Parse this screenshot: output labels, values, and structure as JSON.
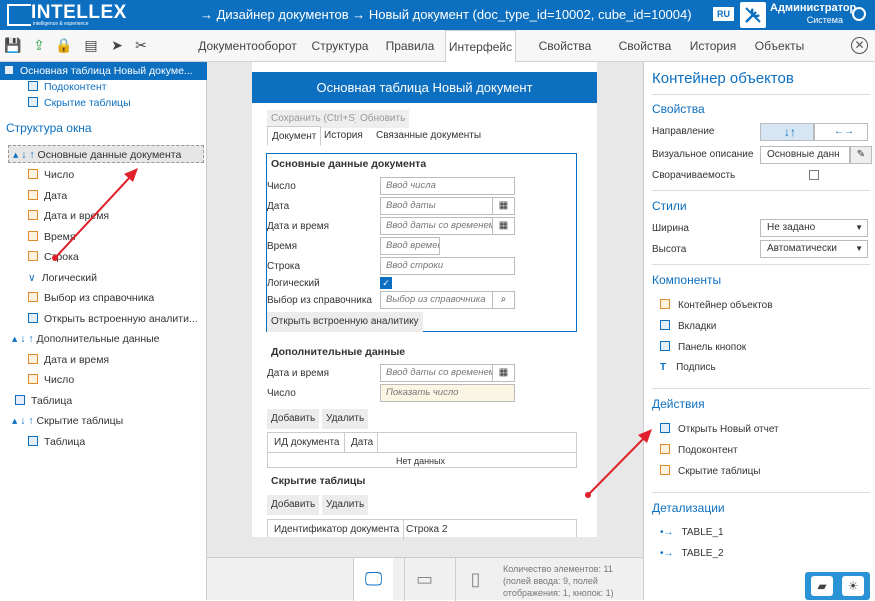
{
  "header": {
    "logo": "INTELLEX",
    "logo_sub": "intelligence & experience",
    "crumb": "→ Дизайнер документов → Новый документ (doc_type_id=10002, cube_id=10004)",
    "lang": "RU",
    "user": "Администратор",
    "role": "Система"
  },
  "tabs": [
    "Документооборот",
    "Структура",
    "Правила",
    "Интерфейс",
    "Свойства списков",
    "Свойства",
    "История",
    "Объекты"
  ],
  "left": {
    "top_item": "Основная таблица Новый докуме...",
    "sub1": "Подоконтент",
    "sub2": "Скрытие таблицы",
    "section": "Структура окна",
    "items": [
      {
        "t": "Основные данные документа"
      },
      {
        "t": "Число"
      },
      {
        "t": "Дата"
      },
      {
        "t": "Дата и время"
      },
      {
        "t": "Время"
      },
      {
        "t": "Строка"
      },
      {
        "t": "Логический"
      },
      {
        "t": "Выбор из справочника"
      },
      {
        "t": "Открыть встроенную аналити..."
      },
      {
        "t": "Дополнительные данные"
      },
      {
        "t": "Дата и время"
      },
      {
        "t": "Число"
      },
      {
        "t": "Таблица"
      },
      {
        "t": "Скрытие таблицы"
      },
      {
        "t": "Таблица"
      }
    ]
  },
  "canvas": {
    "title": "Основная таблица Новый документ",
    "save": "Сохранить (Ctrl+S)",
    "refresh": "Обновить",
    "ctabs": [
      "Документ",
      "История",
      "Связанные документы"
    ],
    "sec1": "Основные данные документа",
    "fields": [
      {
        "l": "Число",
        "p": "Ввод числа"
      },
      {
        "l": "Дата",
        "p": "Ввод даты"
      },
      {
        "l": "Дата и время",
        "p": "Ввод даты со временем"
      },
      {
        "l": "Время",
        "p": "Ввод времени"
      },
      {
        "l": "Строка",
        "p": "Ввод строки"
      },
      {
        "l": "Логический",
        "p": ""
      },
      {
        "l": "Выбор из справочника",
        "p": "Выбор из справочника"
      }
    ],
    "open_analytics": "Открыть встроенную аналитику",
    "sec2": "Дополнительные данные",
    "fields2": [
      {
        "l": "Дата и время",
        "p": "Ввод даты со временем"
      },
      {
        "l": "Число",
        "p": "Показать число"
      }
    ],
    "add": "Добавить",
    "del": "Удалить",
    "grid1": [
      "ИД документа",
      "Дата"
    ],
    "nodata": "Нет данных",
    "sec3": "Скрытие таблицы",
    "grid2": [
      "Идентификатор документа",
      "Строка 2"
    ]
  },
  "footer": {
    "count": "Количество элементов: 11 (полей ввода: 9, полей отображения: 1, кнопок: 1)"
  },
  "right": {
    "title": "Контейнер объектов",
    "props": "Свойства",
    "dir": "Направление",
    "vis": "Визуальное описание",
    "vis_val": "Основные данн",
    "coll": "Сворачиваемость",
    "styles": "Стили",
    "width": "Ширина",
    "width_val": "Не задано",
    "height": "Высота",
    "height_val": "Автоматически",
    "comps": "Компоненты",
    "comp_items": [
      "Контейнер объектов",
      "Вкладки",
      "Панель кнопок",
      "Подпись"
    ],
    "acts": "Действия",
    "act_items": [
      "Открыть Новый отчет",
      "Подоконтент",
      "Скрытие таблицы"
    ],
    "det": "Детализации",
    "det_items": [
      "TABLE_1",
      "TABLE_2"
    ]
  },
  "colors": {
    "accent": "#0c6fc0",
    "arrow": "#e0202a"
  }
}
